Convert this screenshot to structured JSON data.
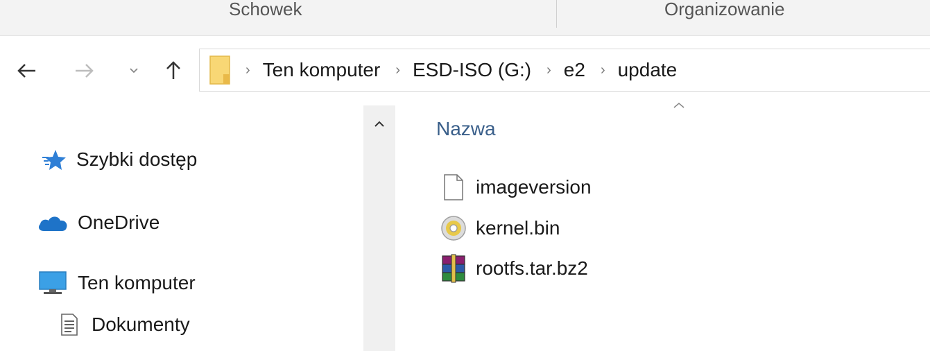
{
  "ribbon": {
    "groups": [
      "Schowek",
      "Organizowanie"
    ]
  },
  "address_bar": {
    "breadcrumbs": [
      "Ten komputer",
      "ESD-ISO (G:)",
      "e2",
      "update"
    ]
  },
  "sidebar": {
    "items": [
      {
        "label": "Szybki dostęp",
        "icon": "quick-access-star-icon"
      },
      {
        "label": "OneDrive",
        "icon": "onedrive-cloud-icon"
      },
      {
        "label": "Ten komputer",
        "icon": "computer-monitor-icon"
      },
      {
        "label": "Dokumenty",
        "icon": "documents-icon"
      }
    ]
  },
  "file_list": {
    "column_header": "Nazwa",
    "files": [
      {
        "name": "imageversion",
        "icon": "blank-file-icon"
      },
      {
        "name": "kernel.bin",
        "icon": "disc-image-icon"
      },
      {
        "name": "rootfs.tar.bz2",
        "icon": "winrar-archive-icon"
      }
    ]
  },
  "colors": {
    "accent_text": "#3a5f8a",
    "folder_yellow": "#f8d775",
    "onedrive_blue": "#1e73c8"
  }
}
